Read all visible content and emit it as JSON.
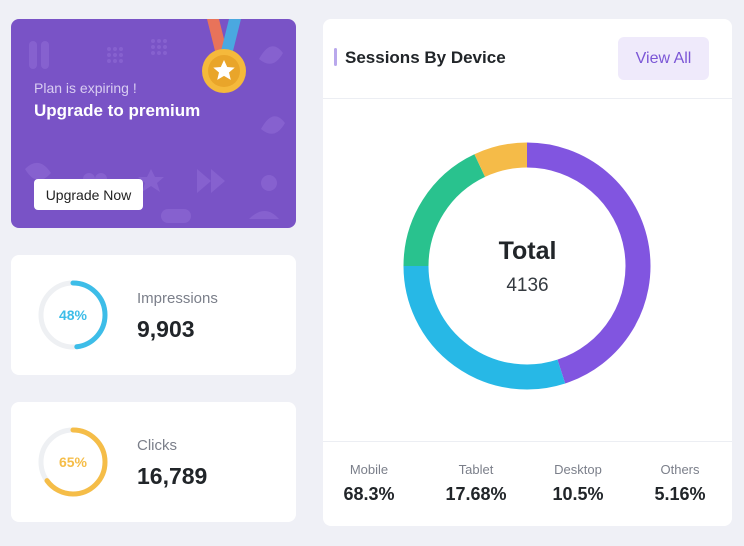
{
  "promo": {
    "subtitle": "Plan is expiring !",
    "title": "Upgrade to premium",
    "button_label": "Upgrade Now"
  },
  "stats": [
    {
      "label": "Impressions",
      "value": "9,903",
      "percent_text": "48%",
      "percent": 0.48,
      "color": "#3dbde8"
    },
    {
      "label": "Clicks",
      "value": "16,789",
      "percent_text": "65%",
      "percent": 0.65,
      "color": "#f5bd48"
    }
  ],
  "sessions": {
    "title": "Sessions By Device",
    "view_all_label": "View All",
    "total_label": "Total",
    "total_value": "4136"
  },
  "chart_data": {
    "type": "pie",
    "donut": true,
    "series": [
      {
        "name": "Mobile",
        "value": 45,
        "color": "#8155e0"
      },
      {
        "name": "Tablet",
        "value": 30,
        "color": "#27b8e6"
      },
      {
        "name": "Desktop",
        "value": 18,
        "color": "#29c28e"
      },
      {
        "name": "Others",
        "value": 7,
        "color": "#f5bb48"
      }
    ]
  },
  "legend": [
    {
      "name": "Mobile",
      "value": "68.3%"
    },
    {
      "name": "Tablet",
      "value": "17.68%"
    },
    {
      "name": "Desktop",
      "value": "10.5%"
    },
    {
      "name": "Others",
      "value": "5.16%"
    }
  ]
}
